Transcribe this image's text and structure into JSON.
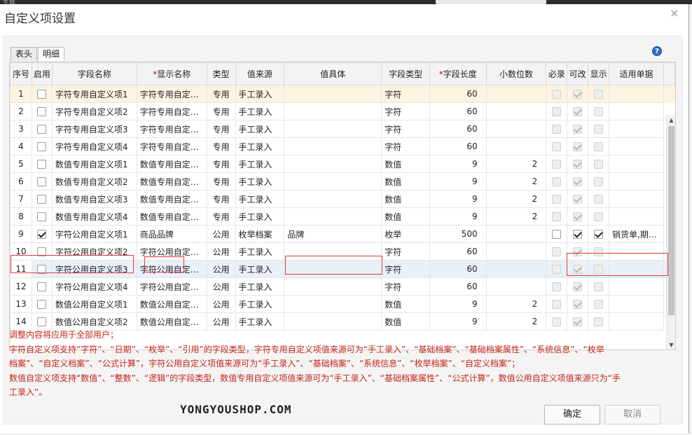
{
  "window": {
    "title": "自定义项设置",
    "close_glyph": "×",
    "behind_text": "生成"
  },
  "tabs": [
    {
      "label": "表头",
      "active": false
    },
    {
      "label": "明细",
      "active": true
    }
  ],
  "help_glyph": "?",
  "columns": [
    {
      "label": "序号",
      "required": false
    },
    {
      "label": "启用",
      "required": false
    },
    {
      "label": "字段名称",
      "required": false
    },
    {
      "label": "显示名称",
      "required": true
    },
    {
      "label": "类型",
      "required": false
    },
    {
      "label": "值来源",
      "required": false
    },
    {
      "label": "值具体",
      "required": false
    },
    {
      "label": "字段类型",
      "required": false
    },
    {
      "label": "字段长度",
      "required": true
    },
    {
      "label": "小数位数",
      "required": false
    },
    {
      "label": "必录",
      "required": false
    },
    {
      "label": "可改",
      "required": false
    },
    {
      "label": "显示",
      "required": false
    },
    {
      "label": "适用单据",
      "required": false
    }
  ],
  "required_mark": "*",
  "rows": [
    {
      "no": "1",
      "enabled": false,
      "name": "字符专用自定义项1",
      "display": "字符专用自定…",
      "type": "专用",
      "source": "手工录入",
      "value": "",
      "field_type": "字符",
      "length": "60",
      "decimals": "",
      "required": false,
      "editable": true,
      "visible": false,
      "docs": "",
      "state": "selected"
    },
    {
      "no": "2",
      "enabled": false,
      "name": "字符专用自定义项2",
      "display": "字符专用自定…",
      "type": "专用",
      "source": "手工录入",
      "value": "",
      "field_type": "字符",
      "length": "60",
      "decimals": "",
      "required": false,
      "editable": true,
      "visible": false,
      "docs": "",
      "state": ""
    },
    {
      "no": "3",
      "enabled": false,
      "name": "字符专用自定义项3",
      "display": "字符专用自定…",
      "type": "专用",
      "source": "手工录入",
      "value": "",
      "field_type": "字符",
      "length": "60",
      "decimals": "",
      "required": false,
      "editable": true,
      "visible": false,
      "docs": "",
      "state": ""
    },
    {
      "no": "4",
      "enabled": false,
      "name": "字符专用自定义项4",
      "display": "字符专用自定…",
      "type": "专用",
      "source": "手工录入",
      "value": "",
      "field_type": "字符",
      "length": "60",
      "decimals": "",
      "required": false,
      "editable": true,
      "visible": false,
      "docs": "",
      "state": ""
    },
    {
      "no": "5",
      "enabled": false,
      "name": "数值专用自定义项1",
      "display": "数值专用自定…",
      "type": "专用",
      "source": "手工录入",
      "value": "",
      "field_type": "数值",
      "length": "9",
      "decimals": "2",
      "required": false,
      "editable": true,
      "visible": false,
      "docs": "",
      "state": ""
    },
    {
      "no": "6",
      "enabled": false,
      "name": "数值专用自定义项2",
      "display": "数值专用自定…",
      "type": "专用",
      "source": "手工录入",
      "value": "",
      "field_type": "数值",
      "length": "9",
      "decimals": "2",
      "required": false,
      "editable": true,
      "visible": false,
      "docs": "",
      "state": ""
    },
    {
      "no": "7",
      "enabled": false,
      "name": "数值专用自定义项3",
      "display": "数值专用自定…",
      "type": "专用",
      "source": "手工录入",
      "value": "",
      "field_type": "数值",
      "length": "9",
      "decimals": "2",
      "required": false,
      "editable": true,
      "visible": false,
      "docs": "",
      "state": ""
    },
    {
      "no": "8",
      "enabled": false,
      "name": "数值专用自定义项4",
      "display": "数值专用自定…",
      "type": "专用",
      "source": "手工录入",
      "value": "",
      "field_type": "数值",
      "length": "9",
      "decimals": "2",
      "required": false,
      "editable": true,
      "visible": false,
      "docs": "",
      "state": ""
    },
    {
      "no": "9",
      "enabled": true,
      "name": "字符公用自定义项1",
      "display": "商品品牌",
      "type": "公用",
      "source": "枚举档案",
      "value": "品牌",
      "field_type": "枚举",
      "length": "500",
      "decimals": "",
      "required": false,
      "editable": true,
      "visible": true,
      "docs": "销货单,期…",
      "state": "",
      "active_checks": true
    },
    {
      "no": "10",
      "enabled": false,
      "name": "字符公用自定义项2",
      "display": "字符公用自定…",
      "type": "公用",
      "source": "手工录入",
      "value": "",
      "field_type": "字符",
      "length": "60",
      "decimals": "",
      "required": false,
      "editable": true,
      "visible": false,
      "docs": "",
      "state": ""
    },
    {
      "no": "11",
      "enabled": false,
      "name": "字符公用自定义项3",
      "display": "字符公用自定…",
      "type": "公用",
      "source": "手工录入",
      "value": "",
      "field_type": "字符",
      "length": "60",
      "decimals": "",
      "required": false,
      "editable": true,
      "visible": false,
      "docs": "",
      "state": "hover"
    },
    {
      "no": "12",
      "enabled": false,
      "name": "字符公用自定义项4",
      "display": "字符公用自定…",
      "type": "公用",
      "source": "手工录入",
      "value": "",
      "field_type": "字符",
      "length": "60",
      "decimals": "",
      "required": false,
      "editable": true,
      "visible": false,
      "docs": "",
      "state": ""
    },
    {
      "no": "13",
      "enabled": false,
      "name": "数值公用自定义项1",
      "display": "数值公用自定…",
      "type": "公用",
      "source": "手工录入",
      "value": "",
      "field_type": "数值",
      "length": "9",
      "decimals": "2",
      "required": false,
      "editable": true,
      "visible": false,
      "docs": "",
      "state": ""
    },
    {
      "no": "14",
      "enabled": false,
      "name": "数值公用自定义项2",
      "display": "数值公用自定…",
      "type": "公用",
      "source": "手工录入",
      "value": "",
      "field_type": "数值",
      "length": "9",
      "decimals": "2",
      "required": false,
      "editable": true,
      "visible": false,
      "docs": "",
      "state": ""
    }
  ],
  "scrollbar": {
    "up_glyph": "▲",
    "down_glyph": "▼"
  },
  "notes": [
    "调整内容将应用于全部用户；",
    "字符自定义项支持“字符”、“日期”、“枚举”、“引用”的字段类型，字符专用自定义项值来源可为“手工录入”、“基础档案”、“基础档案属性”、“系统信息”、“枚举",
    "档案”、“自定义档案”、“公式计算”，字符公用自定义项值来源可为“手工录入”、“基础档案”、“系统信息”、“枚举档案”、“自定义档案”；",
    "数值自定义项支持“数值”、“整数”、“逻辑”的字段类型，数值专用自定义项值来源可为“手工录入”、“基础档案属性”、“公式计算”，数值公用自定义项值来源只为“手",
    "工录入”。"
  ],
  "watermark": "YONGYOUSHOP.COM",
  "buttons": {
    "ok": "确定",
    "cancel": "取消"
  },
  "colors": {
    "notes": "#c4251a",
    "highlight": "#e23b3b",
    "selected_row": "#fdf3e1",
    "hover_row": "#eaf0f8",
    "help": "#2a6fc9"
  }
}
